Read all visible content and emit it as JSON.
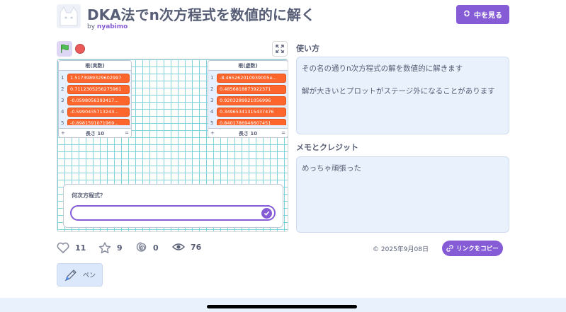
{
  "header": {
    "title": "DKA法でn次方程式を数値的に解く",
    "by_prefix": "by",
    "author": "nyabimo",
    "see_inside_label": "中を見る"
  },
  "stage": {
    "real_list": {
      "title": "根(実数)",
      "items": [
        "1.5173989329602997",
        "0.7112305256275961",
        "-0.0598056393417...",
        "-0.5990435713243...",
        "-0.8981591071969..."
      ],
      "length_label": "長さ 10",
      "add": "+",
      "resize": "="
    },
    "imag_list": {
      "title": "根(虚数)",
      "items": [
        "-8.465262010939005e...",
        "0.4856818873922371",
        "0.9203289921056996",
        "0.34965341315437476",
        "0.8401786946607451"
      ],
      "length_label": "長さ 10",
      "add": "+",
      "resize": "="
    },
    "ask": {
      "question": "何次方程式？",
      "value": ""
    }
  },
  "instructions": {
    "title": "使い方",
    "line1": "その名の通りn次方程式の解を数値的に解きます",
    "line2": "解が大きいとプロットがステージ外になることがあります"
  },
  "notes": {
    "title": "メモとクレジット",
    "text": "めっちゃ頑張った"
  },
  "stats": {
    "loves": "11",
    "favorites": "9",
    "remixes": "0",
    "views": "76"
  },
  "date": "© 2025年9月08日",
  "copy_link_label": "リンクをコピー",
  "extensions": {
    "pen_label": "ペン"
  },
  "colors": {
    "accent": "#855cd6",
    "list_item": "#fc662c",
    "grid": "#7fd3dc",
    "panel": "#e9f1fc"
  }
}
